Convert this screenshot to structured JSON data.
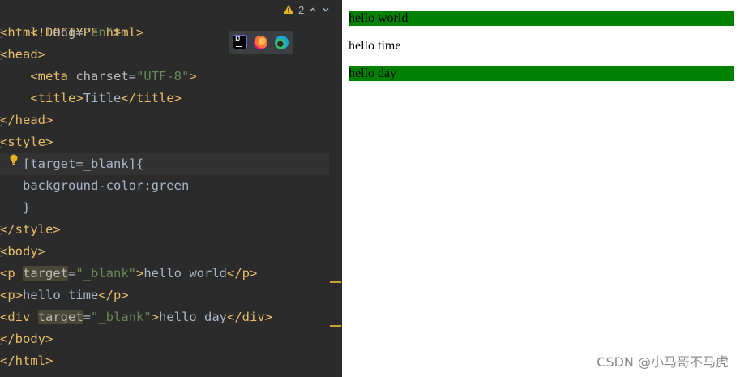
{
  "editor": {
    "inspections": {
      "warning_count": "2"
    },
    "lines": {
      "l1": {
        "tag": "<!DOCTYPE html>"
      },
      "l2": {
        "open": "<html ",
        "attr": "lang",
        "eq": "=",
        "val": "\"en\"",
        "close": ">"
      },
      "l3": {
        "tag": "<head>"
      },
      "l4": {
        "indent": "    ",
        "open": "<meta ",
        "attr": "charset",
        "eq": "=",
        "val": "\"UTF-8\"",
        "close": ">"
      },
      "l5": {
        "indent": "    ",
        "open": "<title>",
        "text": "Title",
        "close": "</title>"
      },
      "l6": {
        "tag": "</head>"
      },
      "l7": {
        "tag": "<style>"
      },
      "l8": {
        "indent": "   ",
        "text": "[target=_blank]{"
      },
      "l9": {
        "indent": "   ",
        "text": "background-color:green"
      },
      "l10": {
        "indent": "   ",
        "text": "}"
      },
      "l11": {
        "tag": "</style>"
      },
      "l12": {
        "tag": "<body>"
      },
      "l13": {
        "open": "<p ",
        "attr": "target",
        "eq": "=",
        "val": "\"_blank\"",
        "close": ">",
        "text": "hello world",
        "end": "</p>"
      },
      "l14": {
        "open": "<p>",
        "text": "hello time",
        "end": "</p>"
      },
      "l15": {
        "open": "<div ",
        "attr": "target",
        "eq": "=",
        "val": "\"_blank\"",
        "close": ">",
        "text": "hello day",
        "end": "</div>"
      },
      "l16": {
        "tag": "</body>"
      },
      "l17": {
        "tag": "</html>"
      }
    }
  },
  "preview": {
    "p1": "hello world",
    "p2": "hello time",
    "div1": "hello day",
    "highlight_color": "#008000"
  },
  "watermark": "CSDN @小马哥不马虎",
  "colors": {
    "editor_bg": "#2b2b2b",
    "tag": "#e8bf6a",
    "string": "#6a8759",
    "text": "#a9b7c6",
    "warning": "#e6b422"
  }
}
